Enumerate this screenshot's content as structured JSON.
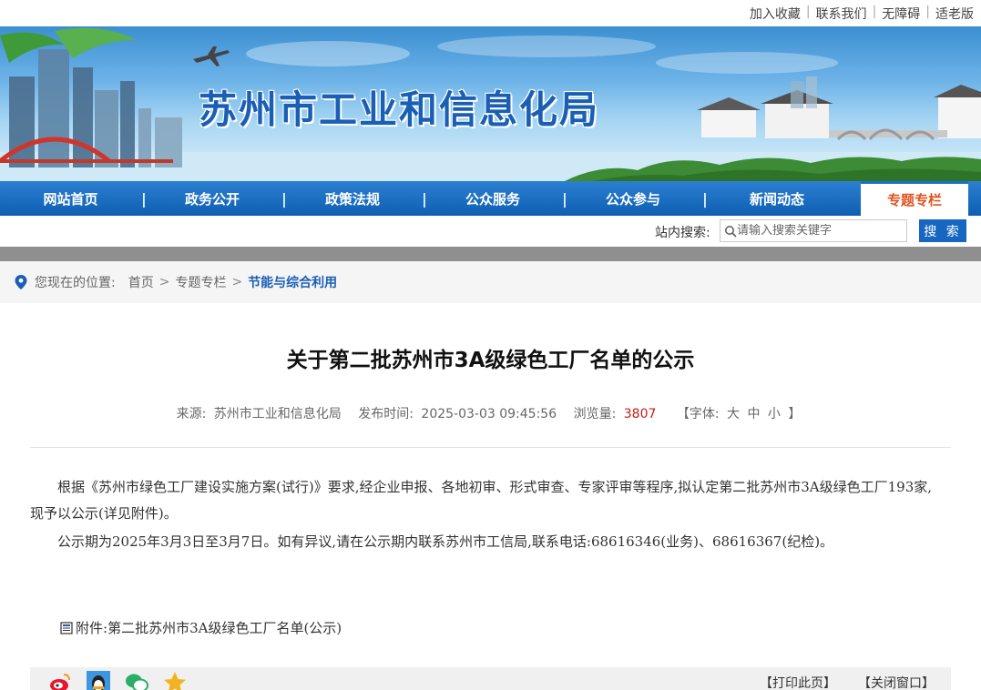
{
  "top_links": [
    "加入收藏",
    "联系我们",
    "无障碍",
    "适老版"
  ],
  "site": {
    "title": "苏州市工业和信息化局"
  },
  "nav": {
    "items": [
      "网站首页",
      "政务公开",
      "政策法规",
      "公众服务",
      "公众参与",
      "新闻动态",
      "专题专栏"
    ],
    "active": "专题专栏"
  },
  "search": {
    "label": "站内搜索:",
    "placeholder": "请输入搜索关键字",
    "button": "搜 索"
  },
  "breadcrumb": {
    "prefix": "您现在的位置:",
    "items": [
      "首页",
      "专题专栏",
      "节能与综合利用"
    ]
  },
  "article": {
    "title": "关于第二批苏州市3A级绿色工厂名单的公示",
    "meta": {
      "source_label": "来源:",
      "source": "苏州市工业和信息化局",
      "time_label": "发布时间:",
      "time": "2025-03-03 09:45:56",
      "views_label": "浏览量:",
      "views": "3807",
      "font_label": "【字体:",
      "font_large": "大",
      "font_medium": "中",
      "font_small": "小",
      "font_end": "】"
    },
    "paragraphs": [
      "根据《苏州市绿色工厂建设实施方案(试行)》要求,经企业申报、各地初审、形式审查、专家评审等程序,拟认定第二批苏州市3A级绿色工厂193家,现予以公示(详见附件)。",
      "公示期为2025年3月3日至3月7日。如有异议,请在公示期内联系苏州市工信局,联系电话:68616346(业务)、68616367(纪检)。"
    ],
    "attachment": {
      "label": "附件:",
      "name": "第二批苏州市3A级绿色工厂名单(公示)"
    }
  },
  "toolbar": {
    "share_icons": [
      "weibo-icon",
      "qq-icon",
      "wechat-icon",
      "favorite-star-icon"
    ],
    "print": "【打印此页】",
    "close": "【关闭窗口】"
  },
  "colors": {
    "nav_blue": "#1466be",
    "title_blue": "#1a5fb4",
    "active_orange": "#e0531d",
    "views_red": "#c01d1d"
  }
}
